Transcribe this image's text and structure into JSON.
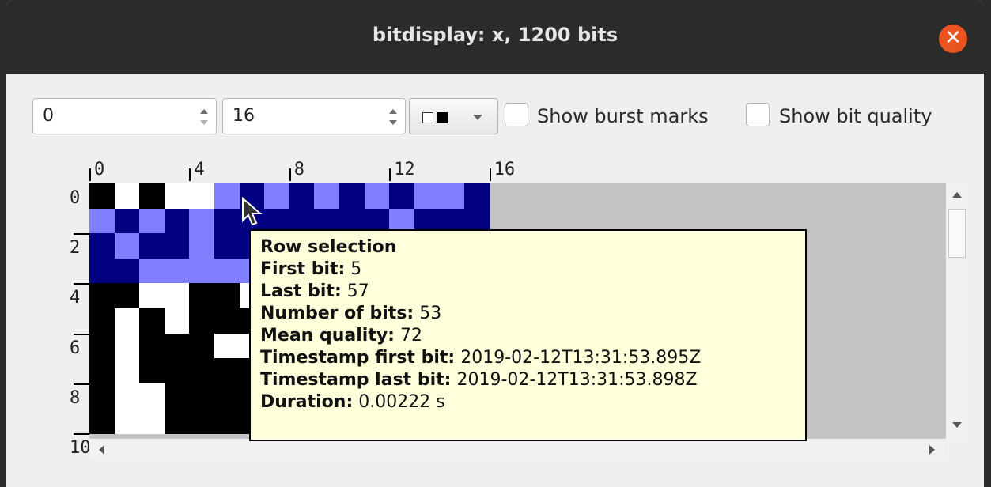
{
  "window": {
    "title": "bitdisplay: x, 1200 bits",
    "close_icon": "close-icon"
  },
  "controls": {
    "start_value": "0",
    "width_value": "16",
    "color_scheme_icon": "black-white-swatch-icon",
    "show_burst_marks_label": "Show burst marks",
    "show_burst_marks_checked": false,
    "show_bit_quality_label": "Show bit quality",
    "show_bit_quality_checked": false
  },
  "column_labels": [
    "0",
    "4",
    "8",
    "12",
    "16"
  ],
  "row_labels": [
    "0",
    "2",
    "4",
    "6",
    "8",
    "10"
  ],
  "bit_rows": [
    "1010001010101001",
    "0101011111110111",
    "1011011101101101",
    "1100000100010101",
    "1100110001100010",
    "1010111101000010",
    "1011100100111000",
    "1011111100000111",
    "1001111110110010",
    "1001111001010000"
  ],
  "selection": {
    "first_bit": 5,
    "last_bit": 57
  },
  "colors": {
    "bit_one": "#000000",
    "bit_zero": "#ffffff",
    "selected_one": "#000080",
    "selected_zero": "#8080ff",
    "empty": "#c4c4c4",
    "tooltip_bg": "#ffffdc"
  },
  "tooltip": {
    "heading": "Row selection",
    "first_bit_label": "First bit:",
    "first_bit_value": "5",
    "last_bit_label": "Last bit:",
    "last_bit_value": "57",
    "num_bits_label": "Number of bits:",
    "num_bits_value": "53",
    "mean_quality_label": "Mean quality:",
    "mean_quality_value": "72",
    "ts_first_label": "Timestamp first bit:",
    "ts_first_value": "2019-02-12T13:31:53.895Z",
    "ts_last_label": "Timestamp last bit:",
    "ts_last_value": "2019-02-12T13:31:53.898Z",
    "duration_label": "Duration:",
    "duration_value": "0.00222 s"
  }
}
